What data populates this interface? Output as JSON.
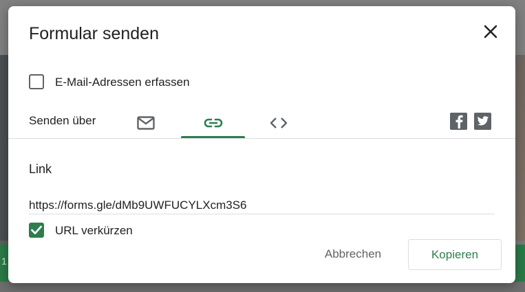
{
  "dialog": {
    "title": "Formular senden",
    "collect_emails_label": "E-Mail-Adressen erfassen",
    "collect_emails_checked": false,
    "send_via_label": "Senden über",
    "tabs": [
      {
        "name": "email",
        "icon": "mail-icon"
      },
      {
        "name": "link",
        "icon": "link-icon",
        "selected": true
      },
      {
        "name": "embed",
        "icon": "code-icon"
      }
    ],
    "social": [
      "facebook-icon",
      "twitter-icon"
    ],
    "link_section": {
      "heading": "Link",
      "url": "https://forms.gle/dMb9UWFUCYLXcm3S6",
      "shorten_label": "URL verkürzen",
      "shorten_checked": true
    },
    "buttons": {
      "cancel": "Abbrechen",
      "copy": "Kopieren"
    }
  },
  "background": {
    "green_bar_text": "1"
  },
  "colors": {
    "accent": "#2e7d4f",
    "text": "#202124",
    "muted": "#5f6368",
    "divider": "#dadce0"
  }
}
